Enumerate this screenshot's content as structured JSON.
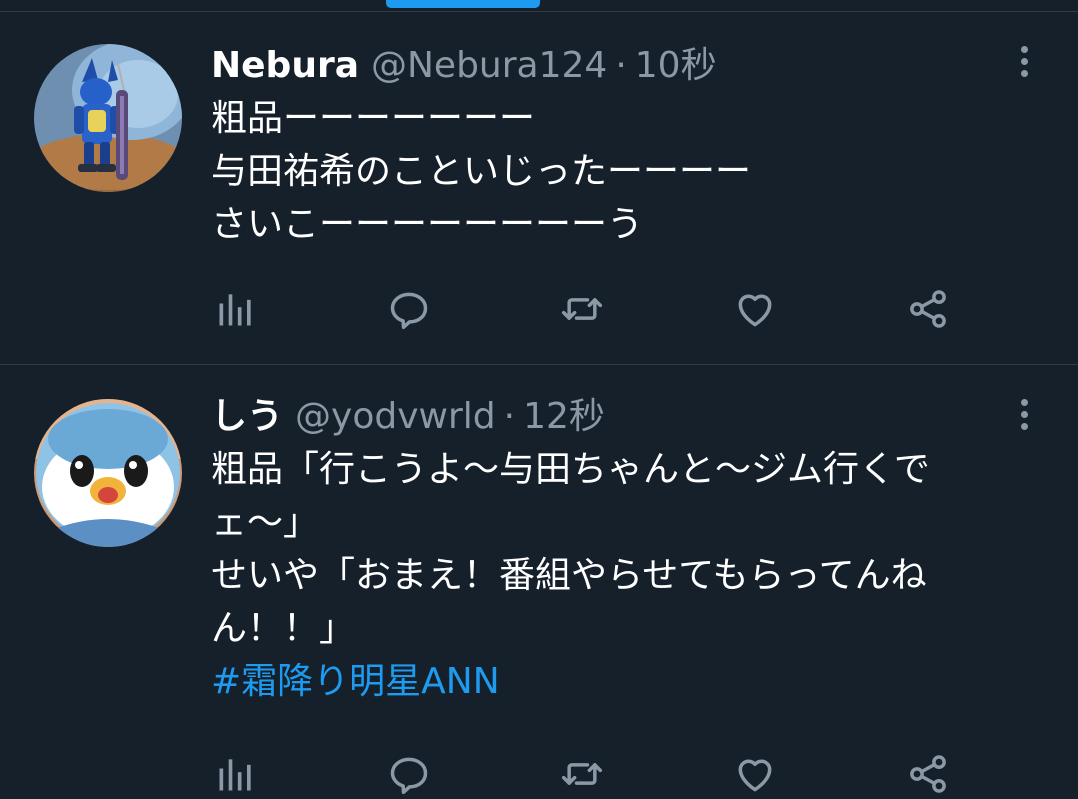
{
  "tweets": [
    {
      "name": "Nebura",
      "handle": "@Nebura124",
      "separator": "·",
      "time": "10秒",
      "lines": [
        "粗品ーーーーーーー",
        "与田祐希のこといじったーーーー",
        "さいこーーーーーーーーう"
      ],
      "avatar_icon": "lucario-avatar"
    },
    {
      "name": "しう",
      "handle": "@yodvwrld",
      "separator": "·",
      "time": "12秒",
      "lines": [
        "粗品「行こうよ〜与田ちゃんと〜ジム行くで",
        "ェ〜」",
        "せいや「おまえ！番組やらせてもらってんね",
        "ん！！」"
      ],
      "hashtag": "#霜降り明星ANN",
      "avatar_icon": "piplup-avatar"
    }
  ],
  "actions": [
    "views-icon",
    "reply-icon",
    "retweet-icon",
    "like-icon",
    "share-icon"
  ],
  "colors": {
    "background": "#15202b",
    "secondary": "#8b98a5",
    "accent": "#1d9bf0",
    "divider": "#2f3b47"
  }
}
